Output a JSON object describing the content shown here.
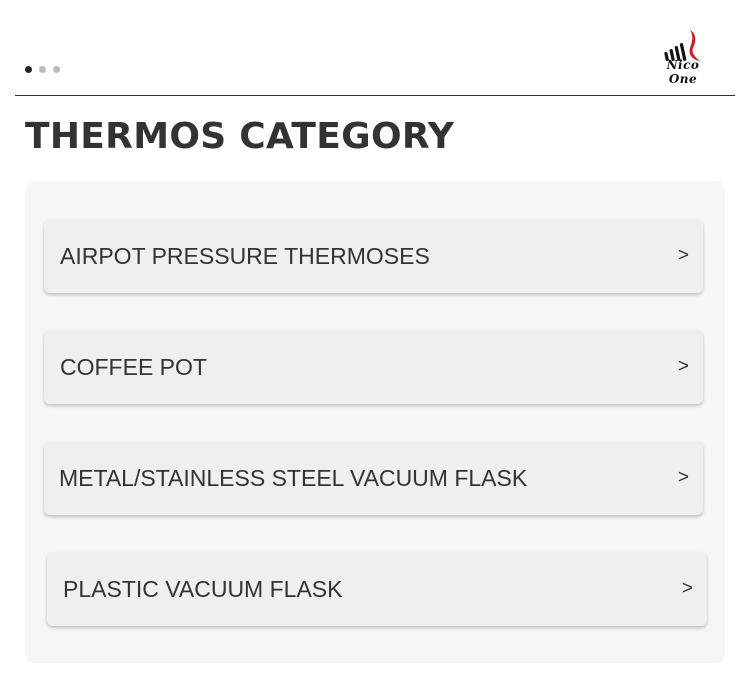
{
  "header": {
    "carousel_dots": [
      {
        "active": true
      },
      {
        "active": false
      },
      {
        "active": false
      }
    ],
    "logo_text": "Nico One",
    "logo_icon": "stylized-brand-mark"
  },
  "page_title": "THERMOS CATEGORY",
  "categories": [
    {
      "label": "AIRPOT PRESSURE THERMOSES",
      "arrow": ">"
    },
    {
      "label": "COFFEE POT",
      "arrow": ">"
    },
    {
      "label": "METAL/STAINLESS STEEL VACUUM FLASK",
      "arrow": ">"
    },
    {
      "label": "PLASTIC VACUUM FLASK",
      "arrow": ">"
    }
  ],
  "colors": {
    "text": "#333333",
    "panel_bg": "#f6f6f6",
    "item_bg": "#efefef",
    "logo_accent": "#cc1f1f"
  }
}
